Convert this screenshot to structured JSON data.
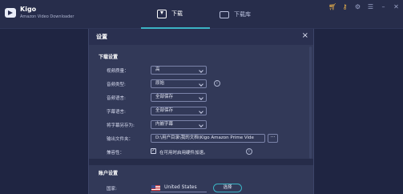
{
  "app": {
    "name": "Kigo",
    "subtitle": "Amazon Video Downloader"
  },
  "tabs": [
    {
      "label": "下载",
      "icon": "download-icon",
      "active": true
    },
    {
      "label": "下载库",
      "icon": "monitor-icon",
      "active": false
    }
  ],
  "window_icons": [
    "cart-icon",
    "key-icon",
    "gear-icon",
    "menu-icon",
    "minimize-icon",
    "close-icon"
  ],
  "dialog": {
    "title": "设置",
    "close": "×",
    "download_section": "下载设置",
    "rows": {
      "video_quality": {
        "label": "视频质量：",
        "value": "高"
      },
      "audio_type": {
        "label": "音频类型:",
        "value": "原始"
      },
      "audio_language": {
        "label": "音频语言:",
        "value": "全部保存"
      },
      "subtitle_language": {
        "label": "字幕语言:",
        "value": "全部保存"
      },
      "save_subtitle_as": {
        "label": "将字幕另存为:",
        "value": "内嵌字幕"
      },
      "output_folder": {
        "label": "输出文件夹：",
        "value": "D:\\用户目录\\我的文档\\Kigo Amazon Prime Vide",
        "browse": "···"
      },
      "hardware_accel": {
        "label": "兼容性：",
        "checked": true,
        "check_mark": "✓",
        "text": "在可用时启用硬件加速。"
      }
    },
    "account_section": "账户设置",
    "account": {
      "country_label": "国家:",
      "country_value": "United States",
      "select_button": "选择"
    },
    "info_icon": "i"
  },
  "colors": {
    "background": "#1f2542",
    "dialog": "#323958",
    "accent": "#3bb3c4",
    "cart": "#f0b54a"
  }
}
